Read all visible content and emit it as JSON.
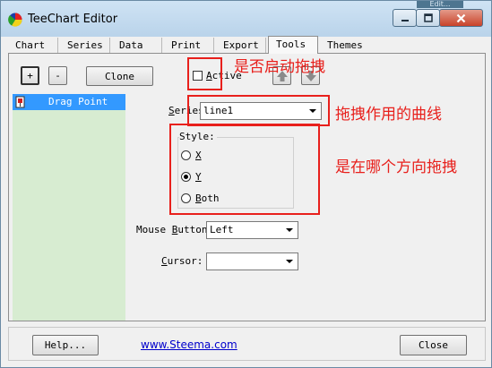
{
  "window": {
    "title": "TeeChart Editor",
    "background_peek_text": "Edit..."
  },
  "tabs": [
    {
      "label": "Chart"
    },
    {
      "label": "Series"
    },
    {
      "label": "Data"
    },
    {
      "label": "Print"
    },
    {
      "label": "Export"
    },
    {
      "label": "Tools",
      "active": true
    },
    {
      "label": "Themes"
    }
  ],
  "toolbar": {
    "add_label": "+",
    "remove_label": "-",
    "clone_label": "Clone",
    "active_label_first": "A",
    "active_label_rest": "ctive",
    "active_checked": false
  },
  "tool_list": {
    "items": [
      {
        "label": "Drag Point",
        "selected": true
      }
    ]
  },
  "series": {
    "label_first": "S",
    "label_rest": "eries:",
    "value": "line1"
  },
  "style": {
    "legend": "Style:",
    "options": [
      {
        "key": "X",
        "label": "X",
        "selected": false
      },
      {
        "key": "Y",
        "label": "Y",
        "selected": true
      },
      {
        "key": "Both",
        "label_first": "B",
        "label_rest": "oth",
        "selected": false
      }
    ]
  },
  "mouse_button": {
    "label_pre": "Mouse ",
    "label_u": "B",
    "label_post": "utton:",
    "value": "Left"
  },
  "cursor": {
    "label_first": "C",
    "label_rest": "ursor:",
    "value": ""
  },
  "annotations": {
    "enable_drag": "是否启动拖拽",
    "drag_series": "拖拽作用的曲线",
    "drag_direction": "是在哪个方向拖拽"
  },
  "footer": {
    "help_label": "Help...",
    "link_text": "www.Steema.com",
    "close_label": "Close"
  },
  "colors": {
    "annotation_red": "#e8201c",
    "selection_blue": "#3399ff",
    "list_green": "#d7ecd1",
    "link_blue": "#0000cc"
  },
  "icons": [
    "teechart-app-icon",
    "minimize-icon",
    "maximize-icon",
    "close-icon",
    "arrow-up-icon",
    "arrow-down-icon",
    "drag-point-icon",
    "chevron-down-icon"
  ]
}
